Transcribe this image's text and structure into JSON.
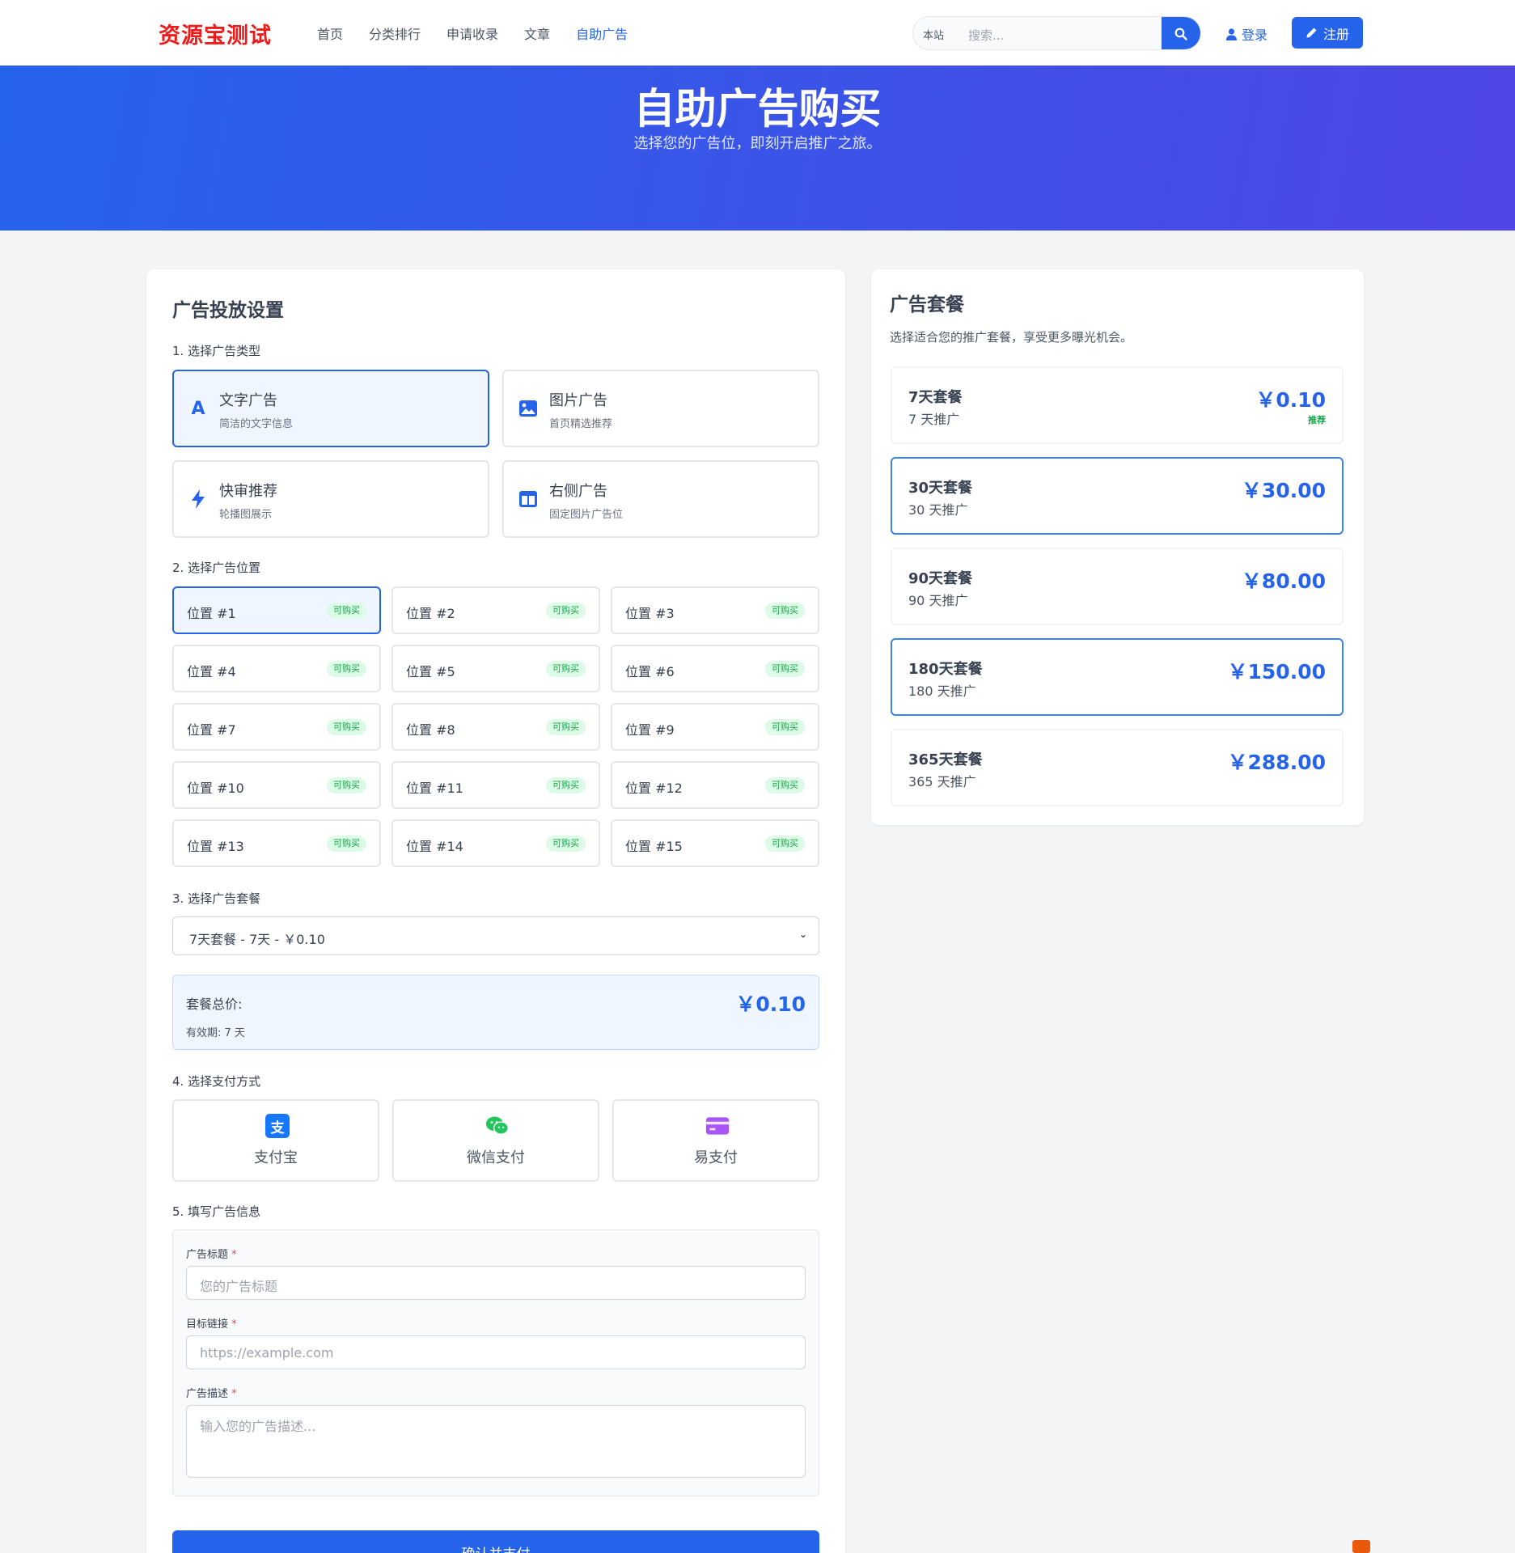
{
  "nav": {
    "logo": "资源宝测试",
    "links": [
      "首页",
      "分类排行",
      "申请收录",
      "文章",
      "自助广告"
    ],
    "search_scope": "本站",
    "search_placeholder": "搜索...",
    "login": "登录",
    "register": "注册"
  },
  "hero": {
    "title": "自助广告购买",
    "subtitle": "选择您的广告位，即刻开启推广之旅。"
  },
  "left": {
    "title": "广告投放设置",
    "step1": "1. 选择广告类型",
    "types": [
      {
        "title": "文字广告",
        "sub": "简洁的文字信息",
        "icon": "text-icon"
      },
      {
        "title": "图片广告",
        "sub": "首页精选推荐",
        "icon": "image-icon"
      },
      {
        "title": "快审推荐",
        "sub": "轮播图展示",
        "icon": "bolt-icon"
      },
      {
        "title": "右侧广告",
        "sub": "固定图片广告位",
        "icon": "columns-icon"
      }
    ],
    "step2": "2. 选择广告位置",
    "positions": [
      "位置 #1",
      "位置 #2",
      "位置 #3",
      "位置 #4",
      "位置 #5",
      "位置 #6",
      "位置 #7",
      "位置 #8",
      "位置 #9",
      "位置 #10",
      "位置 #11",
      "位置 #12",
      "位置 #13",
      "位置 #14",
      "位置 #15"
    ],
    "position_badge": "可购买",
    "step3": "3. 选择广告套餐",
    "selected_package": "7天套餐 - 7天 - ￥0.10",
    "total_label": "套餐总价:",
    "validity": "有效期: 7 天",
    "total_price": "￥0.10",
    "step4": "4. 选择支付方式",
    "payments": [
      {
        "label": "支付宝",
        "icon": "alipay-icon",
        "color": "#1677ff"
      },
      {
        "label": "微信支付",
        "icon": "wechat-icon",
        "color": "#22c55e"
      },
      {
        "label": "易支付",
        "icon": "card-icon",
        "color": "#a855f7"
      }
    ],
    "step5": "5. 填写广告信息",
    "form": {
      "title_label": "广告标题",
      "title_placeholder": "您的广告标题",
      "link_label": "目标链接",
      "link_placeholder": "https://example.com",
      "desc_label": "广告描述",
      "desc_placeholder": "输入您的广告描述...",
      "required_mark": "*"
    },
    "submit": "确认并支付"
  },
  "right": {
    "title": "广告套餐",
    "subtitle": "选择适合您的推广套餐，享受更多曝光机会。",
    "packages": [
      {
        "name": "7天套餐",
        "duration": "7 天推广",
        "price": "￥0.10",
        "tag": "推荐"
      },
      {
        "name": "30天套餐",
        "duration": "30 天推广",
        "price": "￥30.00",
        "tag": ""
      },
      {
        "name": "90天套餐",
        "duration": "90 天推广",
        "price": "￥80.00",
        "tag": ""
      },
      {
        "name": "180天套餐",
        "duration": "180 天推广",
        "price": "￥150.00",
        "tag": ""
      },
      {
        "name": "365天套餐",
        "duration": "365 天推广",
        "price": "￥288.00",
        "tag": ""
      }
    ]
  },
  "colors": {
    "accent": "#2563eb",
    "logo": "#ef1a1a",
    "badge_green": "#16a34a"
  }
}
